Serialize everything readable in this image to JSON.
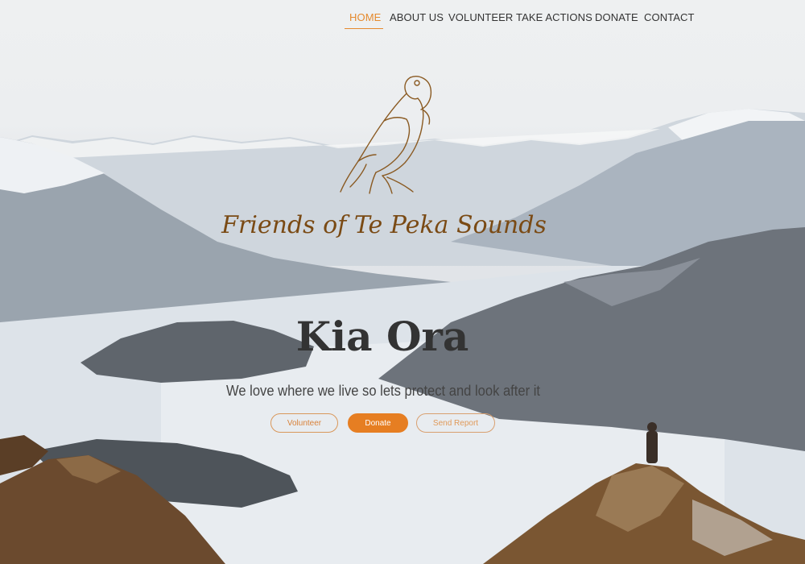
{
  "nav": {
    "items": [
      {
        "label": "HOME",
        "active": true
      },
      {
        "label": "ABOUT US",
        "active": false
      },
      {
        "label": "VOLUNTEER",
        "active": false
      },
      {
        "label": "TAKE ACTIONS",
        "active": false
      },
      {
        "label": "DONATE",
        "active": false
      },
      {
        "label": "CONTACT",
        "active": false
      }
    ]
  },
  "hero": {
    "logo_icon": "kea-bird-icon",
    "site_title": "Friends of Te Peka Sounds",
    "headline": "Kia Ora",
    "tagline": "We love where we live so lets protect and look after it",
    "buttons": {
      "volunteer": "Volunteer",
      "donate": "Donate",
      "send_report": "Send Report"
    }
  },
  "colors": {
    "accent": "#e67e22",
    "title_brown": "#7a4a14",
    "headline_dark": "#333333"
  }
}
